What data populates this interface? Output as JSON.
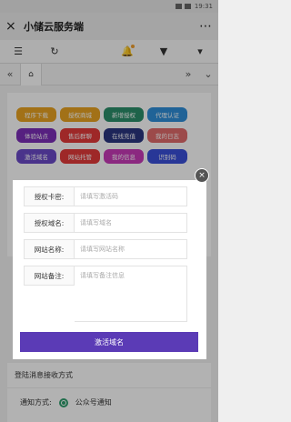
{
  "status_bar": {
    "time": "19:31"
  },
  "titlebar": {
    "close_icon": "×",
    "title": "小储云服务端",
    "more_icon": "⋯"
  },
  "toolbar": {
    "menu_icon": "☰",
    "refresh_icon": "↻",
    "bell_icon": "🔔",
    "dropdown_icon": "▼",
    "extra_icon": "▾"
  },
  "tabbar": {
    "prev_icon": "«",
    "home_icon": "⌂",
    "next_icon": "»",
    "chevron_icon": "⌄"
  },
  "buttons": [
    {
      "label": "程序下载",
      "color": "#e8a321"
    },
    {
      "label": "授权商城",
      "color": "#e8a321"
    },
    {
      "label": "新增授权",
      "color": "#2c8f6a"
    },
    {
      "label": "代理认证",
      "color": "#2e8fd8"
    },
    {
      "label": "体验站点",
      "color": "#7b2fb8"
    },
    {
      "label": "售后群聊",
      "color": "#e23a3a"
    },
    {
      "label": "在线充值",
      "color": "#2a3580"
    },
    {
      "label": "我的日志",
      "color": "#e06a6a"
    },
    {
      "label": "激活域名",
      "color": "#6a4ac8"
    },
    {
      "label": "网站托管",
      "color": "#e23a3a"
    },
    {
      "label": "我的信息",
      "color": "#c73ab8"
    },
    {
      "label": "识别码",
      "color": "#3a4fd8"
    }
  ],
  "notify": {
    "heading": "登陆消息接收方式",
    "label": "通知方式:",
    "option": "公众号通知"
  },
  "modal": {
    "close_icon": "×",
    "fields": [
      {
        "label": "授权卡密:",
        "placeholder": "请填写激活码"
      },
      {
        "label": "授权域名:",
        "placeholder": "请填写域名"
      },
      {
        "label": "网站名称:",
        "placeholder": "请填写网站名称"
      },
      {
        "label": "网站备注:",
        "placeholder": "请填写备注信息"
      }
    ],
    "submit": "激活域名"
  }
}
